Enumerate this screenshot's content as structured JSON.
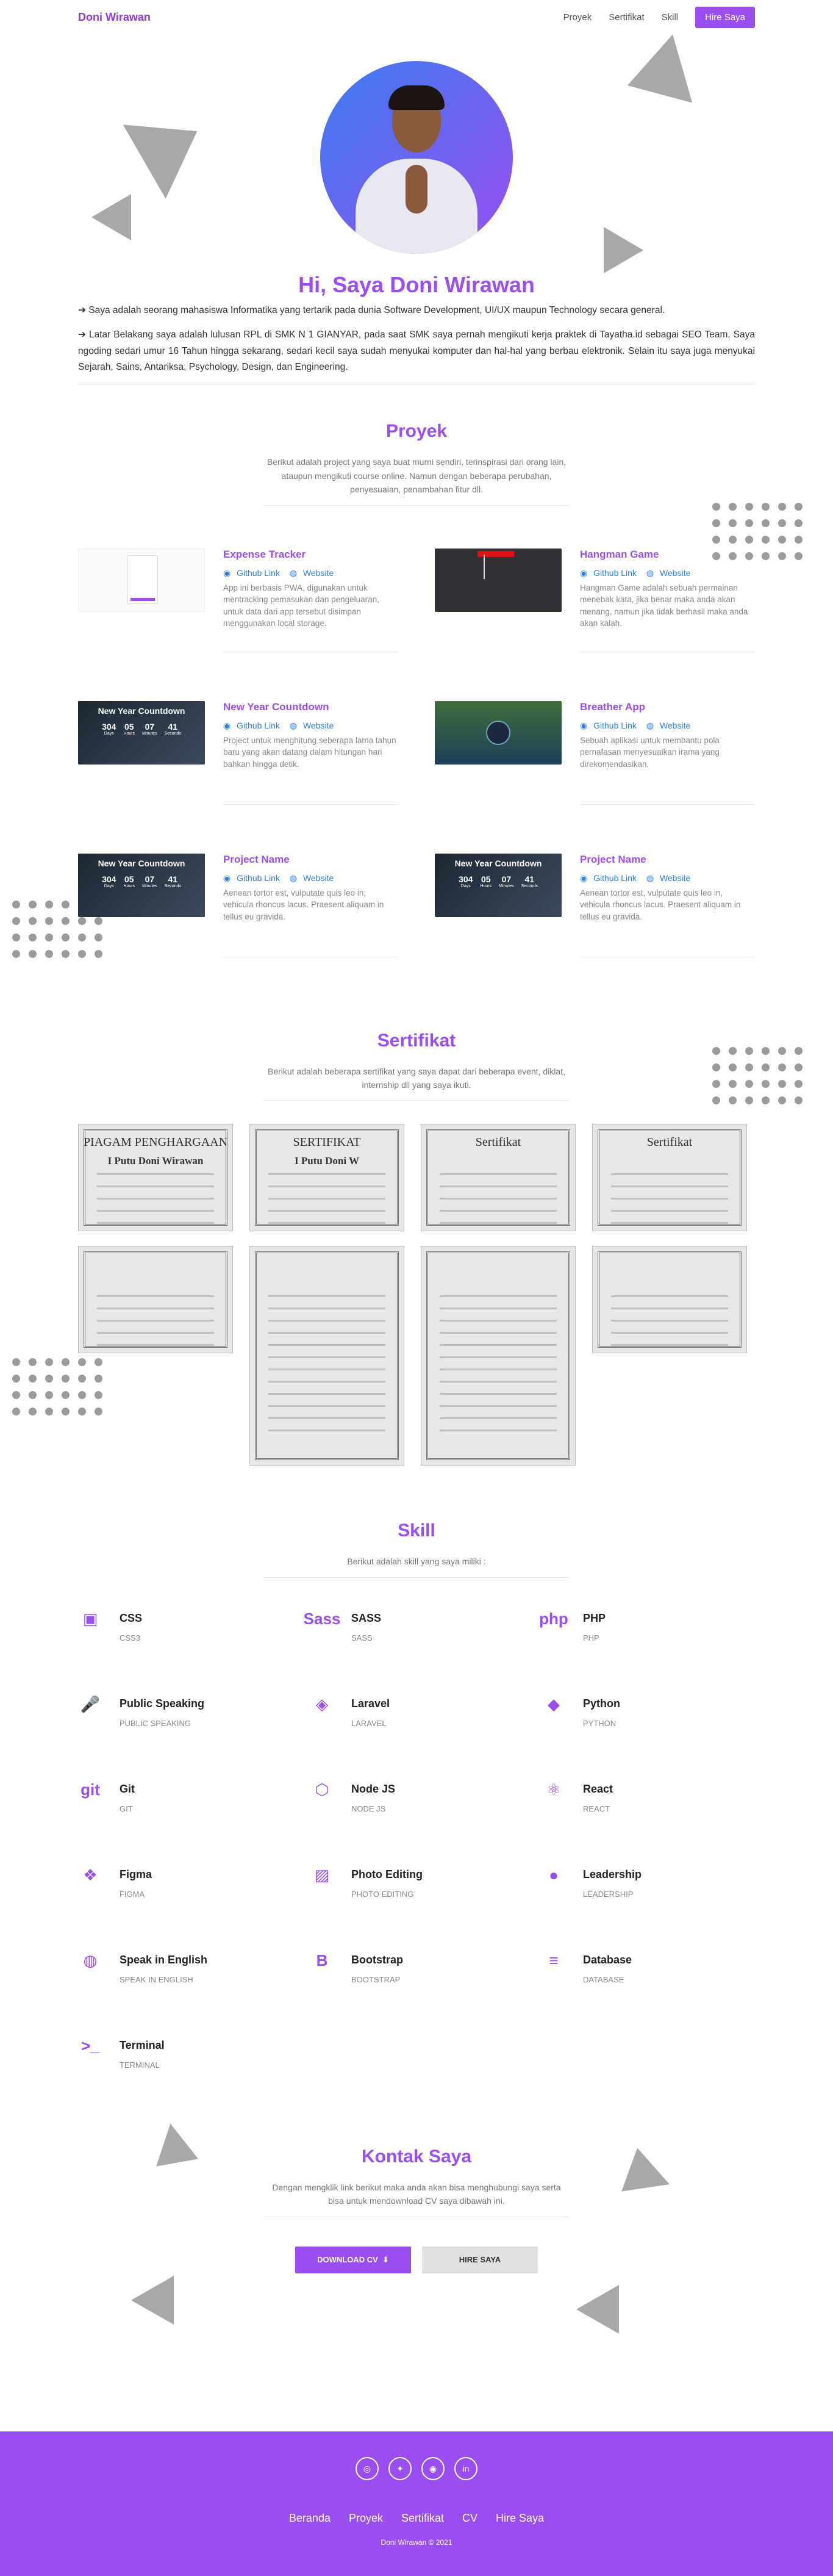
{
  "nav": {
    "brand": "Doni Wirawan",
    "links": [
      "Proyek",
      "Sertifikat",
      "Skill"
    ],
    "hire": "Hire Saya"
  },
  "hero": {
    "title": "Hi, Saya Doni Wirawan",
    "p1": "Saya adalah seorang mahasiswa Informatika yang tertarik pada dunia Software Development, UI/UX maupun Technology secara general.",
    "p2": "Latar Belakang saya adalah lulusan RPL di SMK N 1 GIANYAR, pada saat SMK saya pernah mengikuti kerja praktek di Tayatha.id sebagai SEO Team. Saya ngoding sedari umur 16 Tahun hingga sekarang, sedari kecil saya sudah menyukai komputer dan hal-hal yang berbau elektronik. Selain itu saya juga menyukai Sejarah, Sains, Antariksa, Psychology, Design, dan Engineering."
  },
  "projects": {
    "title": "Proyek",
    "desc": "Berikut adalah project yang saya buat murni sendiri, terinspirasi dari orang lain, ataupun mengikuti course online. Namun dengan beberapa perubahan, penyesuaian, penambahan fitur dll.",
    "github_label": "Github Link",
    "website_label": "Website",
    "items": [
      {
        "name": "Expense Tracker",
        "desc": "App ini berbasis PWA, digunakan untuk mentracking pemasukan dan pengeluaran, untuk data dari app tersebut disimpan menggunakan local storage."
      },
      {
        "name": "Hangman Game",
        "desc": "Hangman Game adalah sebuah permainan menebak kata, jika benar maka anda akan menang, namun jika tidak berhasil maka anda akan kalah."
      },
      {
        "name": "New Year Countdown",
        "desc": "Project untuk menghitung seberapa lama tahun baru yang akan datang dalam hitungan hari bahkan hingga detik."
      },
      {
        "name": "Breather App",
        "desc": "Sebuah aplikasi untuk membantu pola pernafasan menyesuaikan irama yang direkomendasikan."
      },
      {
        "name": "Project Name",
        "desc": "Aenean tortor est, vulputate quis leo in, vehicula rhoncus lacus. Praesent aliquam in tellus eu gravida."
      },
      {
        "name": "Project Name",
        "desc": "Aenean tortor est, vulputate quis leo in, vehicula rhoncus lacus. Praesent aliquam in tellus eu gravida."
      }
    ],
    "countdown": {
      "title": "New Year Countdown",
      "nums": [
        "304",
        "05",
        "07",
        "41"
      ],
      "units": [
        "Days",
        "Hours",
        "Minutes",
        "Seconds"
      ]
    }
  },
  "certs": {
    "title": "Sertifikat",
    "desc": "Berikut adalah beberapa sertifikat yang saya dapat dari beberapa event, diklat, internship dll yang saya ikuti.",
    "card_titles": [
      "PIAGAM PENGHARGAAN",
      "SERTIFIKAT",
      "Sertifikat",
      "Sertifikat",
      "",
      "",
      "",
      ""
    ],
    "names": [
      "I Putu Doni Wirawan",
      "I Putu Doni W",
      "",
      "",
      "",
      "",
      "",
      ""
    ]
  },
  "skills": {
    "title": "Skill",
    "desc": "Berikut adalah skill yang saya miliki :",
    "items": [
      {
        "name": "CSS",
        "sub": "CSS3",
        "icon": "css3-icon",
        "glyph": "▣"
      },
      {
        "name": "SASS",
        "sub": "SASS",
        "icon": "sass-icon",
        "glyph": "Sass"
      },
      {
        "name": "PHP",
        "sub": "PHP",
        "icon": "php-icon",
        "glyph": "php"
      },
      {
        "name": "Public Speaking",
        "sub": "Public Speaking",
        "icon": "microphone-icon",
        "glyph": "🎤"
      },
      {
        "name": "Laravel",
        "sub": "Laravel",
        "icon": "laravel-icon",
        "glyph": "◈"
      },
      {
        "name": "Python",
        "sub": "Python",
        "icon": "python-icon",
        "glyph": "◆"
      },
      {
        "name": "Git",
        "sub": "Git",
        "icon": "git-icon",
        "glyph": "git"
      },
      {
        "name": "Node JS",
        "sub": "Node JS",
        "icon": "nodejs-icon",
        "glyph": "⬡"
      },
      {
        "name": "React",
        "sub": "React",
        "icon": "react-icon",
        "glyph": "⚛"
      },
      {
        "name": "Figma",
        "sub": "Figma",
        "icon": "figma-icon",
        "glyph": "❖"
      },
      {
        "name": "Photo Editing",
        "sub": "Photo Editing",
        "icon": "image-icon",
        "glyph": "▨"
      },
      {
        "name": "Leadership",
        "sub": "Leadership",
        "icon": "user-icon",
        "glyph": "●"
      },
      {
        "name": "Speak in English",
        "sub": "Speak in English",
        "icon": "globe-icon",
        "glyph": "◍"
      },
      {
        "name": "Bootstrap",
        "sub": "Bootstrap",
        "icon": "bootstrap-icon",
        "glyph": "B"
      },
      {
        "name": "Database",
        "sub": "Database",
        "icon": "database-icon",
        "glyph": "≡"
      },
      {
        "name": "Terminal",
        "sub": "Terminal",
        "icon": "terminal-icon",
        "glyph": ">_"
      }
    ]
  },
  "contact": {
    "title": "Kontak Saya",
    "desc": "Dengan mengklik link berikut maka anda akan bisa menghubungi saya serta bisa untuk mendownload CV saya dibawah ini.",
    "download": "DOWNLOAD CV",
    "hire": "HIRE SAYA"
  },
  "footer": {
    "social": [
      "instagram-icon",
      "twitter-icon",
      "github-icon",
      "linkedin-icon"
    ],
    "links": [
      "Beranda",
      "Proyek",
      "Sertifikat",
      "CV",
      "Hire Saya"
    ],
    "copyright": "Doni Wirawan © 2021"
  },
  "colors": {
    "accent": "#9a4ef0",
    "link": "#2f7fe0",
    "triangle": "#a8a8a8"
  }
}
